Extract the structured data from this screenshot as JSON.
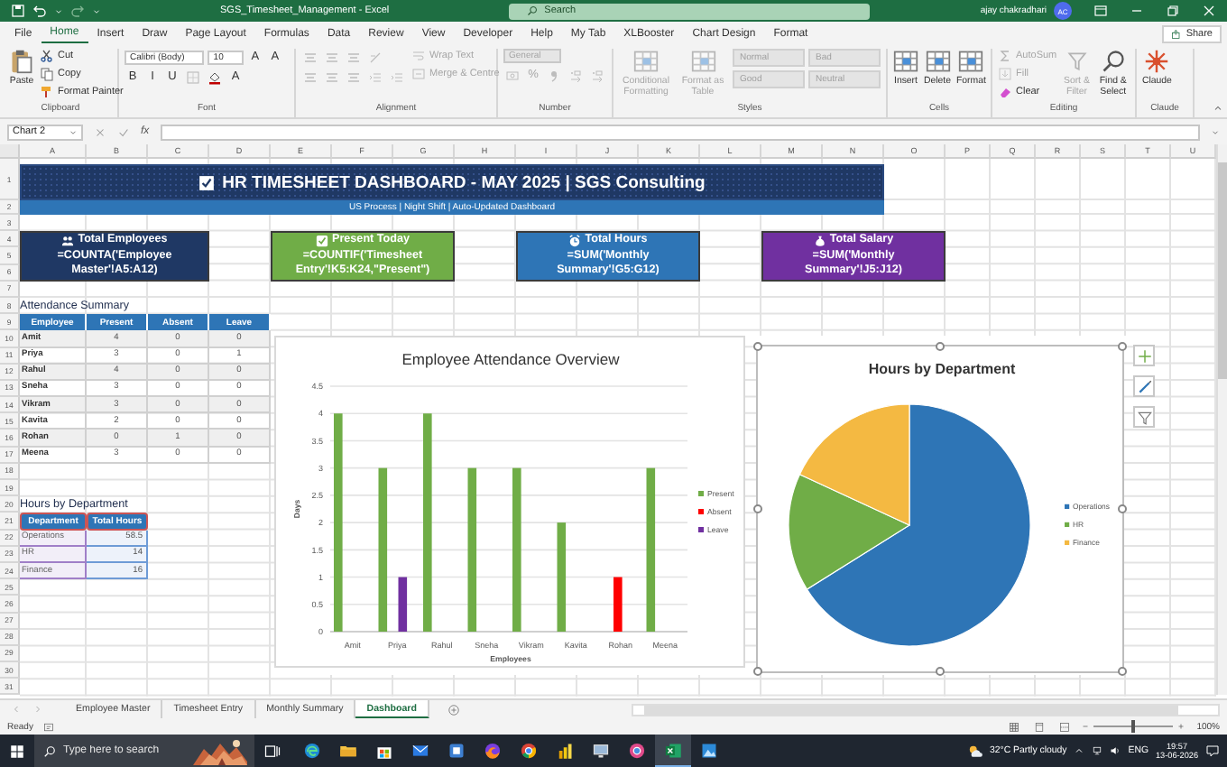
{
  "window": {
    "title": "SGS_Timesheet_Management - Excel",
    "search_placeholder": "Search",
    "user": "ajay chakradhari",
    "avatar": "AC"
  },
  "menu_tabs": [
    {
      "label": "File",
      "selected": false
    },
    {
      "label": "Home",
      "selected": true
    },
    {
      "label": "Insert",
      "selected": false
    },
    {
      "label": "Draw",
      "selected": false
    },
    {
      "label": "Page Layout",
      "selected": false
    },
    {
      "label": "Formulas",
      "selected": false
    },
    {
      "label": "Data",
      "selected": false
    },
    {
      "label": "Review",
      "selected": false
    },
    {
      "label": "View",
      "selected": false
    },
    {
      "label": "Developer",
      "selected": false
    },
    {
      "label": "Help",
      "selected": false
    },
    {
      "label": "My Tab",
      "selected": false
    },
    {
      "label": "XLBooster",
      "selected": false
    },
    {
      "label": "Chart Design",
      "selected": false
    },
    {
      "label": "Format",
      "selected": false
    }
  ],
  "share": "Share",
  "ribbon": [
    {
      "label": "Clipboard",
      "items": [
        {
          "kind": "large",
          "label": "Paste",
          "disabled": false
        },
        {
          "kind": "stack",
          "lines": [
            [
              {
                "kind": "small",
                "label": "Cut",
                "disabled": false
              }
            ],
            [
              {
                "kind": "small",
                "label": "Copy",
                "disabled": false
              }
            ],
            [
              {
                "kind": "small",
                "label": "Format Painter",
                "disabled": false
              }
            ]
          ]
        }
      ]
    },
    {
      "label": "Font",
      "items": [
        {
          "kind": "stack",
          "lines": [
            [
              {
                "kind": "combo",
                "label": "Calibri (Body)",
                "disabled": false
              },
              {
                "kind": "combo",
                "label": "10",
                "disabled": false
              },
              {
                "kind": "glyph",
                "label": "A",
                "disabled": false
              },
              {
                "kind": "glyph",
                "label": "A",
                "disabled": false
              }
            ],
            [
              {
                "kind": "glyph",
                "label": "B",
                "disabled": false
              },
              {
                "kind": "glyph",
                "label": "I",
                "disabled": false
              },
              {
                "kind": "glyph",
                "label": "U",
                "disabled": false
              },
              {
                "kind": "icon",
                "disabled": true
              },
              {
                "kind": "icon",
                "disabled": false
              },
              {
                "kind": "glyph",
                "label": "A",
                "disabled": false
              }
            ]
          ]
        }
      ]
    },
    {
      "label": "Alignment",
      "items": [
        {
          "kind": "stack",
          "lines": [
            [
              {
                "kind": "icon",
                "disabled": true
              },
              {
                "kind": "icon",
                "disabled": true
              },
              {
                "kind": "icon",
                "disabled": true
              },
              {
                "kind": "icon",
                "disabled": true
              }
            ],
            [
              {
                "kind": "icon",
                "disabled": true
              },
              {
                "kind": "icon",
                "disabled": true
              },
              {
                "kind": "icon",
                "disabled": true
              },
              {
                "kind": "icon",
                "disabled": true
              },
              {
                "kind": "icon",
                "disabled": true
              }
            ]
          ]
        },
        {
          "kind": "stack",
          "lines": [
            [
              {
                "kind": "small",
                "label": "Wrap Text",
                "disabled": true
              }
            ],
            [
              {
                "kind": "small",
                "label": "Merge & Centre",
                "disabled": true
              }
            ]
          ]
        }
      ]
    },
    {
      "label": "Number",
      "items": [
        {
          "kind": "stack",
          "lines": [
            [
              {
                "kind": "combo",
                "label": "General",
                "disabled": true
              }
            ],
            [
              {
                "kind": "icon",
                "disabled": true
              },
              {
                "kind": "glyph",
                "label": "%",
                "disabled": true
              },
              {
                "kind": "icon",
                "disabled": true
              },
              {
                "kind": "icon",
                "disabled": true
              },
              {
                "kind": "icon",
                "disabled": true
              }
            ]
          ]
        }
      ]
    },
    {
      "label": "Styles",
      "items": [
        {
          "kind": "large",
          "label": "Conditional Formatting",
          "disabled": true
        },
        {
          "kind": "large",
          "label": "Format as Table",
          "disabled": true
        },
        {
          "kind": "stack",
          "lines": [
            [
              {
                "kind": "style",
                "label": "Normal",
                "disabled": true
              },
              {
                "kind": "style",
                "label": "Bad",
                "disabled": true
              }
            ],
            [
              {
                "kind": "style",
                "label": "Good",
                "disabled": true
              },
              {
                "kind": "style",
                "label": "Neutral",
                "disabled": true
              }
            ]
          ]
        }
      ]
    },
    {
      "label": "Cells",
      "items": [
        {
          "kind": "large",
          "label": "Insert",
          "disabled": false
        },
        {
          "kind": "large",
          "label": "Delete",
          "disabled": false
        },
        {
          "kind": "large",
          "label": "Format",
          "disabled": false
        }
      ]
    },
    {
      "label": "Editing",
      "items": [
        {
          "kind": "stack",
          "lines": [
            [
              {
                "kind": "small",
                "label": "AutoSum",
                "disabled": true
              }
            ],
            [
              {
                "kind": "small",
                "label": "Fill",
                "disabled": true
              }
            ],
            [
              {
                "kind": "small",
                "label": "Clear",
                "disabled": false
              }
            ]
          ]
        },
        {
          "kind": "large",
          "label": "Sort & Filter",
          "disabled": true
        },
        {
          "kind": "large",
          "label": "Find & Select",
          "disabled": false
        }
      ]
    },
    {
      "label": "Claude",
      "items": [
        {
          "kind": "large",
          "label": "Claude",
          "disabled": false
        }
      ]
    }
  ],
  "name_box": "Chart 2",
  "fx_label": "fx",
  "sheet": {
    "columns": [
      "A",
      "B",
      "C",
      "D",
      "E",
      "F",
      "G",
      "H",
      "I",
      "J",
      "K",
      "L",
      "M",
      "N",
      "O",
      "P",
      "Q",
      "R",
      "S",
      "T",
      "U"
    ],
    "rows": [
      "1",
      "2",
      "3",
      "4",
      "5",
      "6",
      "7",
      "8",
      "9",
      "10",
      "11",
      "12",
      "13",
      "14",
      "15",
      "16",
      "17",
      "18",
      "19",
      "20",
      "21",
      "22",
      "23",
      "24",
      "25",
      "26",
      "27",
      "28",
      "29",
      "30",
      "31"
    ],
    "banner": {
      "title": "HR TIMESHEET DASHBOARD - MAY 2025 | SGS Consulting",
      "subtitle": "US Process | Night Shift | Auto-Updated Dashboard"
    },
    "kpis": [
      {
        "title": "Total Employees",
        "formula": "=COUNTA('Employee Master'!A5:A12)",
        "color": "#1f3864"
      },
      {
        "title": "Present Today",
        "formula": "=COUNTIF('Timesheet Entry'!K5:K24,\"Present\")",
        "color": "#70ad47"
      },
      {
        "title": "Total Hours",
        "formula": "=SUM('Monthly Summary'!G5:G12)",
        "color": "#2e75b6"
      },
      {
        "title": "Total Salary",
        "formula": "=SUM('Monthly Summary'!J5:J12)",
        "color": "#7030a0"
      }
    ],
    "attendance": {
      "title": "Attendance Summary",
      "columns": [
        "Employee",
        "Present",
        "Absent",
        "Leave"
      ],
      "rows": [
        [
          "Amit",
          "4",
          "0",
          "0"
        ],
        [
          "Priya",
          "3",
          "0",
          "1"
        ],
        [
          "Rahul",
          "4",
          "0",
          "0"
        ],
        [
          "Sneha",
          "3",
          "0",
          "0"
        ],
        [
          "Vikram",
          "3",
          "0",
          "0"
        ],
        [
          "Kavita",
          "2",
          "0",
          "0"
        ],
        [
          "Rohan",
          "0",
          "1",
          "0"
        ],
        [
          "Meena",
          "3",
          "0",
          "0"
        ]
      ]
    },
    "hours": {
      "title": "Hours by Department",
      "columns": [
        "Department",
        "Total Hours"
      ],
      "rows": [
        [
          "Operations",
          "58.5"
        ],
        [
          "HR",
          "14"
        ],
        [
          "Finance",
          "16"
        ]
      ]
    },
    "bar_chart": {
      "chart_data": {
        "type": "bar",
        "title": "Employee Attendance Overview",
        "xlabel": "Employees",
        "ylabel": "Days",
        "categories": [
          "Amit",
          "Priya",
          "Rahul",
          "Sneha",
          "Vikram",
          "Kavita",
          "Rohan",
          "Meena"
        ],
        "series": [
          {
            "name": "Present",
            "color": "#70ad47",
            "values": [
              4,
              3,
              4,
              3,
              3,
              2,
              0,
              3
            ]
          },
          {
            "name": "Absent",
            "color": "#ff0000",
            "values": [
              0,
              0,
              0,
              0,
              0,
              0,
              1,
              0
            ]
          },
          {
            "name": "Leave",
            "color": "#7030a0",
            "values": [
              0,
              1,
              0,
              0,
              0,
              0,
              0,
              0
            ]
          }
        ],
        "ylim": [
          0,
          4.5
        ],
        "yticks": [
          {
            "value": 0,
            "label": "0"
          },
          {
            "value": 0.5,
            "label": "0.5"
          },
          {
            "value": 1,
            "label": "1"
          },
          {
            "value": 1.5,
            "label": "1.5"
          },
          {
            "value": 2,
            "label": "2"
          },
          {
            "value": 2.5,
            "label": "2.5"
          },
          {
            "value": 3,
            "label": "3"
          },
          {
            "value": 3.5,
            "label": "3.5"
          },
          {
            "value": 4,
            "label": "4"
          },
          {
            "value": 4.5,
            "label": "4.5"
          }
        ],
        "grid": true,
        "legend": true
      }
    },
    "pie_chart": {
      "selected": true,
      "chart_data": {
        "type": "pie",
        "title": "Hours by Department",
        "categories": [
          "Operations",
          "HR",
          "Finance"
        ],
        "values": [
          66.1,
          15.8,
          18.1
        ],
        "legend": true
      }
    }
  },
  "sheet_tabs": [
    {
      "label": "Employee Master",
      "selected": false
    },
    {
      "label": "Timesheet Entry",
      "selected": false
    },
    {
      "label": "Monthly Summary",
      "selected": false
    },
    {
      "label": "Dashboard",
      "selected": true
    }
  ],
  "status_bar": {
    "text": "Ready",
    "zoom": "100%",
    "zoom_slider": {
      "level": 0.5
    }
  },
  "taskbar": {
    "search_placeholder": "Type here to search",
    "apps": [
      {
        "active": false
      },
      {
        "active": false
      },
      {
        "active": false
      },
      {
        "active": false
      },
      {
        "active": false
      },
      {
        "active": false
      },
      {
        "active": false
      },
      {
        "active": false
      },
      {
        "active": false
      },
      {
        "active": false
      },
      {
        "active": true
      },
      {
        "active": false
      }
    ],
    "weather": "32°C Partly cloudy",
    "language": "ENG",
    "time": "19:57",
    "date": "13-06-2026"
  }
}
